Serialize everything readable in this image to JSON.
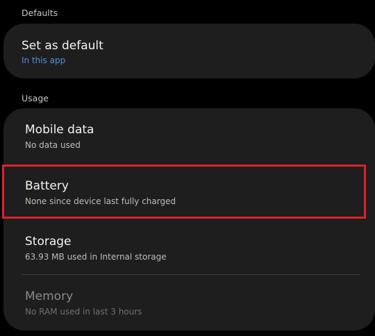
{
  "defaults": {
    "header": "Defaults",
    "set_as_default": {
      "title": "Set as default",
      "subtitle": "In this app"
    }
  },
  "usage": {
    "header": "Usage",
    "items": [
      {
        "title": "Mobile data",
        "subtitle": "No data used"
      },
      {
        "title": "Battery",
        "subtitle": "None since device last fully charged"
      },
      {
        "title": "Storage",
        "subtitle": "63.93 MB used in Internal storage"
      },
      {
        "title": "Memory",
        "subtitle": "No RAM used in last 3 hours"
      }
    ]
  },
  "colors": {
    "background": "#000000",
    "card": "#1e1e1e",
    "accent": "#4f8fe3",
    "highlight": "#e0202a"
  }
}
